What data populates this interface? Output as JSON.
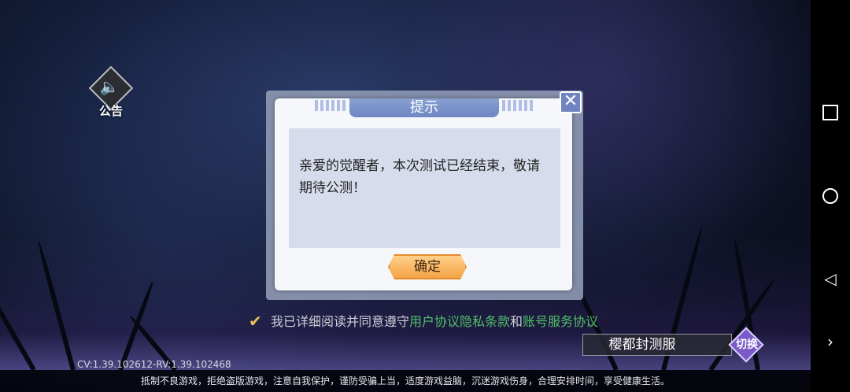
{
  "announcement": {
    "icon": "speaker-icon",
    "label": "公告"
  },
  "dialog": {
    "title": "提示",
    "message": "亲爱的觉醒者，本次测试已经结束，敬请期待公测！",
    "confirm_label": "确定",
    "close_symbol": "✕"
  },
  "agreement": {
    "checked": true,
    "prefix": "我已详细阅读并同意遵守",
    "link1": "用户协议隐私条款",
    "and": "和",
    "link2": "账号服务协议"
  },
  "server": {
    "name": "樱都封测服",
    "switch_label": "切换"
  },
  "version": "CV:1.39.102612-RV:1.39.102468",
  "footer": "抵制不良游戏，拒绝盗版游戏，注意自我保护，谨防受骗上当，适度游戏益脑，沉迷游戏伤身，合理安排时间，享受健康生活。",
  "navbar": [
    "recents-icon",
    "home-icon",
    "back-icon",
    "expand-icon"
  ],
  "colors": {
    "accent": "#6e86c2",
    "confirm": "#f4a447",
    "link": "#4fc06a"
  }
}
